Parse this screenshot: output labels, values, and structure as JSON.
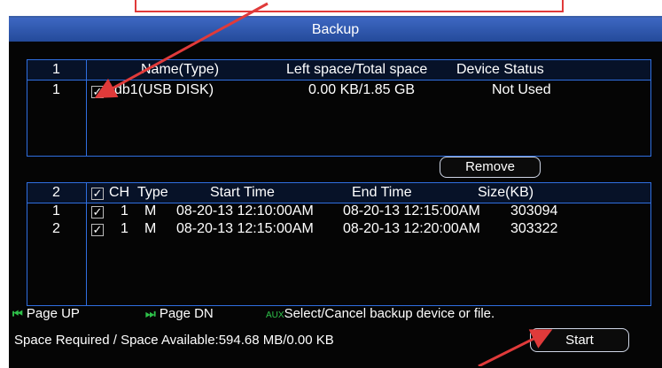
{
  "window": {
    "title": "Backup"
  },
  "devices": {
    "header": {
      "index": "1",
      "name": "Name(Type)",
      "space": "Left space/Total space",
      "status": "Device Status"
    },
    "rows": [
      {
        "index": "1",
        "checked": "✓",
        "name": "sdb1(USB DISK)",
        "space": "0.00 KB/1.85 GB",
        "status": "Not Used"
      }
    ]
  },
  "remove_label": "Remove",
  "files": {
    "header": {
      "index": "2",
      "ch": "CH",
      "type": "Type",
      "start": "Start Time",
      "end": "End Time",
      "size": "Size(KB)"
    },
    "rows": [
      {
        "index": "1",
        "checked": "✓",
        "ch": "1",
        "type": "M",
        "start": "08-20-13 12:10:00AM",
        "end": "08-20-13 12:15:00AM",
        "size": "303094"
      },
      {
        "index": "2",
        "checked": "✓",
        "ch": "1",
        "type": "M",
        "start": "08-20-13 12:15:00AM",
        "end": "08-20-13 12:20:00AM",
        "size": "303322"
      }
    ]
  },
  "legend": {
    "page_up": "Page UP",
    "page_dn": "Page DN",
    "aux_tag": "AUX",
    "aux_text": "Select/Cancel backup device or file."
  },
  "space_info": "Space Required / Space Available:594.68 MB/0.00 KB",
  "start_label": "Start",
  "colors": {
    "accent_blue": "#2f6fe0",
    "title_bar": "#2b52a6",
    "callout_red": "#e03a3a",
    "legend_green": "#2ec24a"
  }
}
